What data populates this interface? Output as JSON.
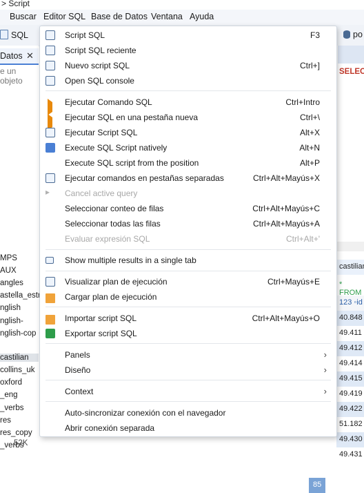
{
  "window": {
    "title": "> Script"
  },
  "menubar": [
    "Buscar",
    "Editor SQL",
    "Base de Datos",
    "Ventana",
    "Ayuda"
  ],
  "toolbar": {
    "sql_label": "SQL",
    "right_label": "po"
  },
  "left_panel": {
    "tab_label": "Datos",
    "filter_placeholder": "e un objeto",
    "tree_items": [
      "MPS",
      "AUX",
      "angles",
      "astella_estr",
      "nglish",
      "nglish-",
      "nglish-cop",
      "castilian",
      "collins_uk",
      "oxford",
      "_eng",
      "_verbs",
      "res",
      "res_copy",
      "_verbs"
    ],
    "selected_index": 7,
    "size_label": "52K"
  },
  "right_panel": {
    "selec_label": "SELEC",
    "castilian_label": "castilian",
    "from_label": "* FROM",
    "id_header": "123 ◦id",
    "values": [
      "40.848",
      "49.411",
      "49.412",
      "49.414",
      "49.415",
      "49.419",
      "49.422",
      "51.182",
      "49.430",
      "49.431"
    ],
    "row_num": "85"
  },
  "menu": {
    "items": [
      {
        "label": "Script SQL",
        "shortcut": "F3",
        "icon": "script-icon"
      },
      {
        "label": "Script SQL reciente",
        "shortcut": "",
        "icon": "recent-script-icon"
      },
      {
        "label": "Nuevo script SQL",
        "shortcut": "Ctrl+]",
        "icon": "new-script-icon"
      },
      {
        "label": "Open SQL console",
        "shortcut": "",
        "icon": "console-icon"
      },
      {
        "label": "Ejecutar Comando SQL",
        "shortcut": "Ctrl+Intro",
        "icon": "play-icon"
      },
      {
        "label": "Ejecutar SQL en una pestaña nueva",
        "shortcut": "Ctrl+\\",
        "icon": "play-new-tab-icon"
      },
      {
        "label": "Ejecutar Script SQL",
        "shortcut": "Alt+X",
        "icon": "run-script-icon"
      },
      {
        "label": "Execute SQL Script natively",
        "shortcut": "Alt+N",
        "icon": "native-run-icon"
      },
      {
        "label": "Execute SQL script from the position",
        "shortcut": "Alt+P",
        "icon": ""
      },
      {
        "label": "Ejecutar comandos en pestañas separadas",
        "shortcut": "Ctrl+Alt+Mayús+X",
        "icon": "run-tabs-icon"
      },
      {
        "label": "Cancel active query",
        "shortcut": "",
        "icon": "cancel-icon",
        "disabled": true
      },
      {
        "label": "Seleccionar conteo de filas",
        "shortcut": "Ctrl+Alt+Mayús+C",
        "icon": ""
      },
      {
        "label": "Seleccionar todas las filas",
        "shortcut": "Ctrl+Alt+Mayús+A",
        "icon": ""
      },
      {
        "label": "Evaluar expresión SQL",
        "shortcut": "Ctrl+Alt+'",
        "icon": "",
        "disabled": true
      },
      {
        "label": "Show multiple results in a single tab",
        "shortcut": "",
        "icon": "multi-results-icon"
      },
      {
        "label": "Visualizar plan de ejecución",
        "shortcut": "Ctrl+Mayús+E",
        "icon": "plan-icon"
      },
      {
        "label": "Cargar plan de ejecución",
        "shortcut": "",
        "icon": "load-plan-icon"
      },
      {
        "label": "Importar script SQL",
        "shortcut": "Ctrl+Alt+Mayús+O",
        "icon": "import-icon"
      },
      {
        "label": "Exportar script SQL",
        "shortcut": "",
        "icon": "export-icon"
      },
      {
        "label": "Panels",
        "shortcut": "",
        "icon": "",
        "submenu": true
      },
      {
        "label": "Diseño",
        "shortcut": "",
        "icon": "",
        "submenu": true
      },
      {
        "label": "Context",
        "shortcut": "",
        "icon": "",
        "submenu": true
      },
      {
        "label": "Auto-sincronizar conexión con el navegador",
        "shortcut": "",
        "icon": ""
      },
      {
        "label": "Abrir conexión separada",
        "shortcut": "",
        "icon": ""
      }
    ]
  }
}
